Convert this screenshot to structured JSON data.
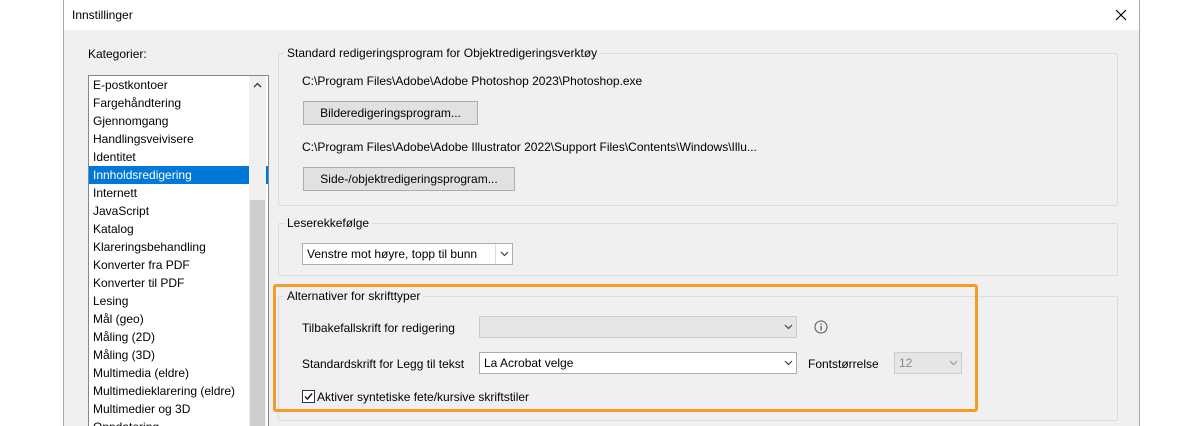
{
  "window": {
    "title": "Innstillinger"
  },
  "categories": {
    "label": "Kategorier:",
    "items": [
      "E-postkontoer",
      "Fargehåndtering",
      "Gjennomgang",
      "Handlingsveivisere",
      "Identitet",
      "Innholdsredigering",
      "Internett",
      "JavaScript",
      "Katalog",
      "Klareringsbehandling",
      "Konverter fra PDF",
      "Konverter til PDF",
      "Lesing",
      "Mål (geo)",
      "Måling (2D)",
      "Måling (3D)",
      "Multimedia (eldre)",
      "Multimedieklarering (eldre)",
      "Multimedier og 3D",
      "Oppdatering"
    ],
    "selected": "Innholdsredigering"
  },
  "editors": {
    "legend": "Standard redigeringsprogram for Objektredigeringsverktøy",
    "image_path": "C:\\Program Files\\Adobe\\Adobe Photoshop 2023\\Photoshop.exe",
    "image_button": "Bilderedigeringsprogram...",
    "page_path": "C:\\Program Files\\Adobe\\Adobe Illustrator 2022\\Support Files\\Contents\\Windows\\Illu...",
    "page_button": "Side-/objektredigeringsprogram..."
  },
  "reading_order": {
    "legend": "Leserekkefølge",
    "value": "Venstre mot høyre, topp til bunn"
  },
  "fonts": {
    "legend": "Alternativer for skrifttyper",
    "fallback_label": "Tilbakefallskrift for redigering",
    "fallback_value": "",
    "default_label": "Standardskrift for Legg til tekst",
    "default_value": "La Acrobat velge",
    "size_label": "Fontstørrelse",
    "size_value": "12",
    "synthetic_label": "Aktiver syntetiske fete/kursive skriftstiler",
    "synthetic_checked": true
  },
  "colors": {
    "highlight": "#f39c28",
    "selection": "#0078d7"
  }
}
